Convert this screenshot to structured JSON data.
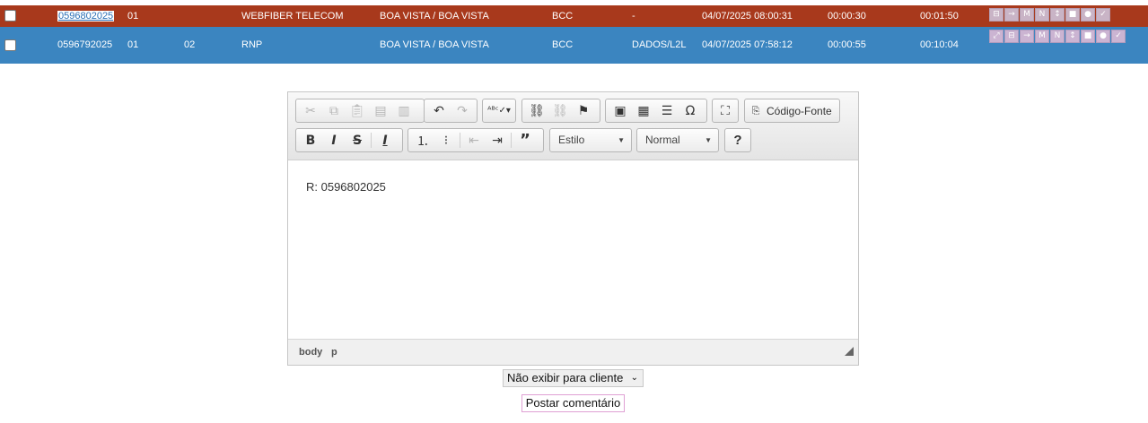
{
  "tickets": [
    {
      "id": "0596802025",
      "col2": "01",
      "col3": "",
      "client": "WEBFIBER TELECOM",
      "location": "BOA VISTA / BOA VISTA",
      "origin": "BCC",
      "service": "-",
      "datetime": "04/07/2025 08:00:31",
      "time1": "00:00:30",
      "time2": "00:01:50",
      "actions": [
        "⊟",
        "→",
        "M",
        "N",
        "↕",
        "■",
        "●",
        "✓"
      ]
    },
    {
      "id": "0596792025",
      "col2": "01",
      "col3": "02",
      "client": "RNP",
      "location": "BOA VISTA / BOA VISTA",
      "origin": "BCC",
      "service": "DADOS/L2L",
      "datetime": "04/07/2025 07:58:12",
      "time1": "00:00:55",
      "time2": "00:10:04",
      "actions": [
        "⤢",
        "⊟",
        "→",
        "M",
        "N",
        "↕",
        "■",
        "●",
        "✓"
      ]
    }
  ],
  "editor": {
    "source_label": "Código-Fonte",
    "style_combo": "Estilo",
    "format_combo": "Normal",
    "help_label": "?",
    "content": "R: 0596802025",
    "path": [
      "body",
      "p"
    ],
    "icons": {
      "cut": "scissors-icon",
      "copy": "copy-icon",
      "paste": "paste-icon",
      "undo": "undo-icon",
      "redo": "redo-icon",
      "spellcheck": "spellcheck-icon",
      "link": "link-icon",
      "unlink": "unlink-icon",
      "anchor": "flag-icon",
      "image": "image-icon",
      "table": "table-icon",
      "hr": "horizontal-rule-icon",
      "special": "omega-icon",
      "maximize": "maximize-icon"
    }
  },
  "visibility": {
    "selected": "Não exibir para cliente"
  },
  "post_button": {
    "label": "Postar comentário"
  }
}
